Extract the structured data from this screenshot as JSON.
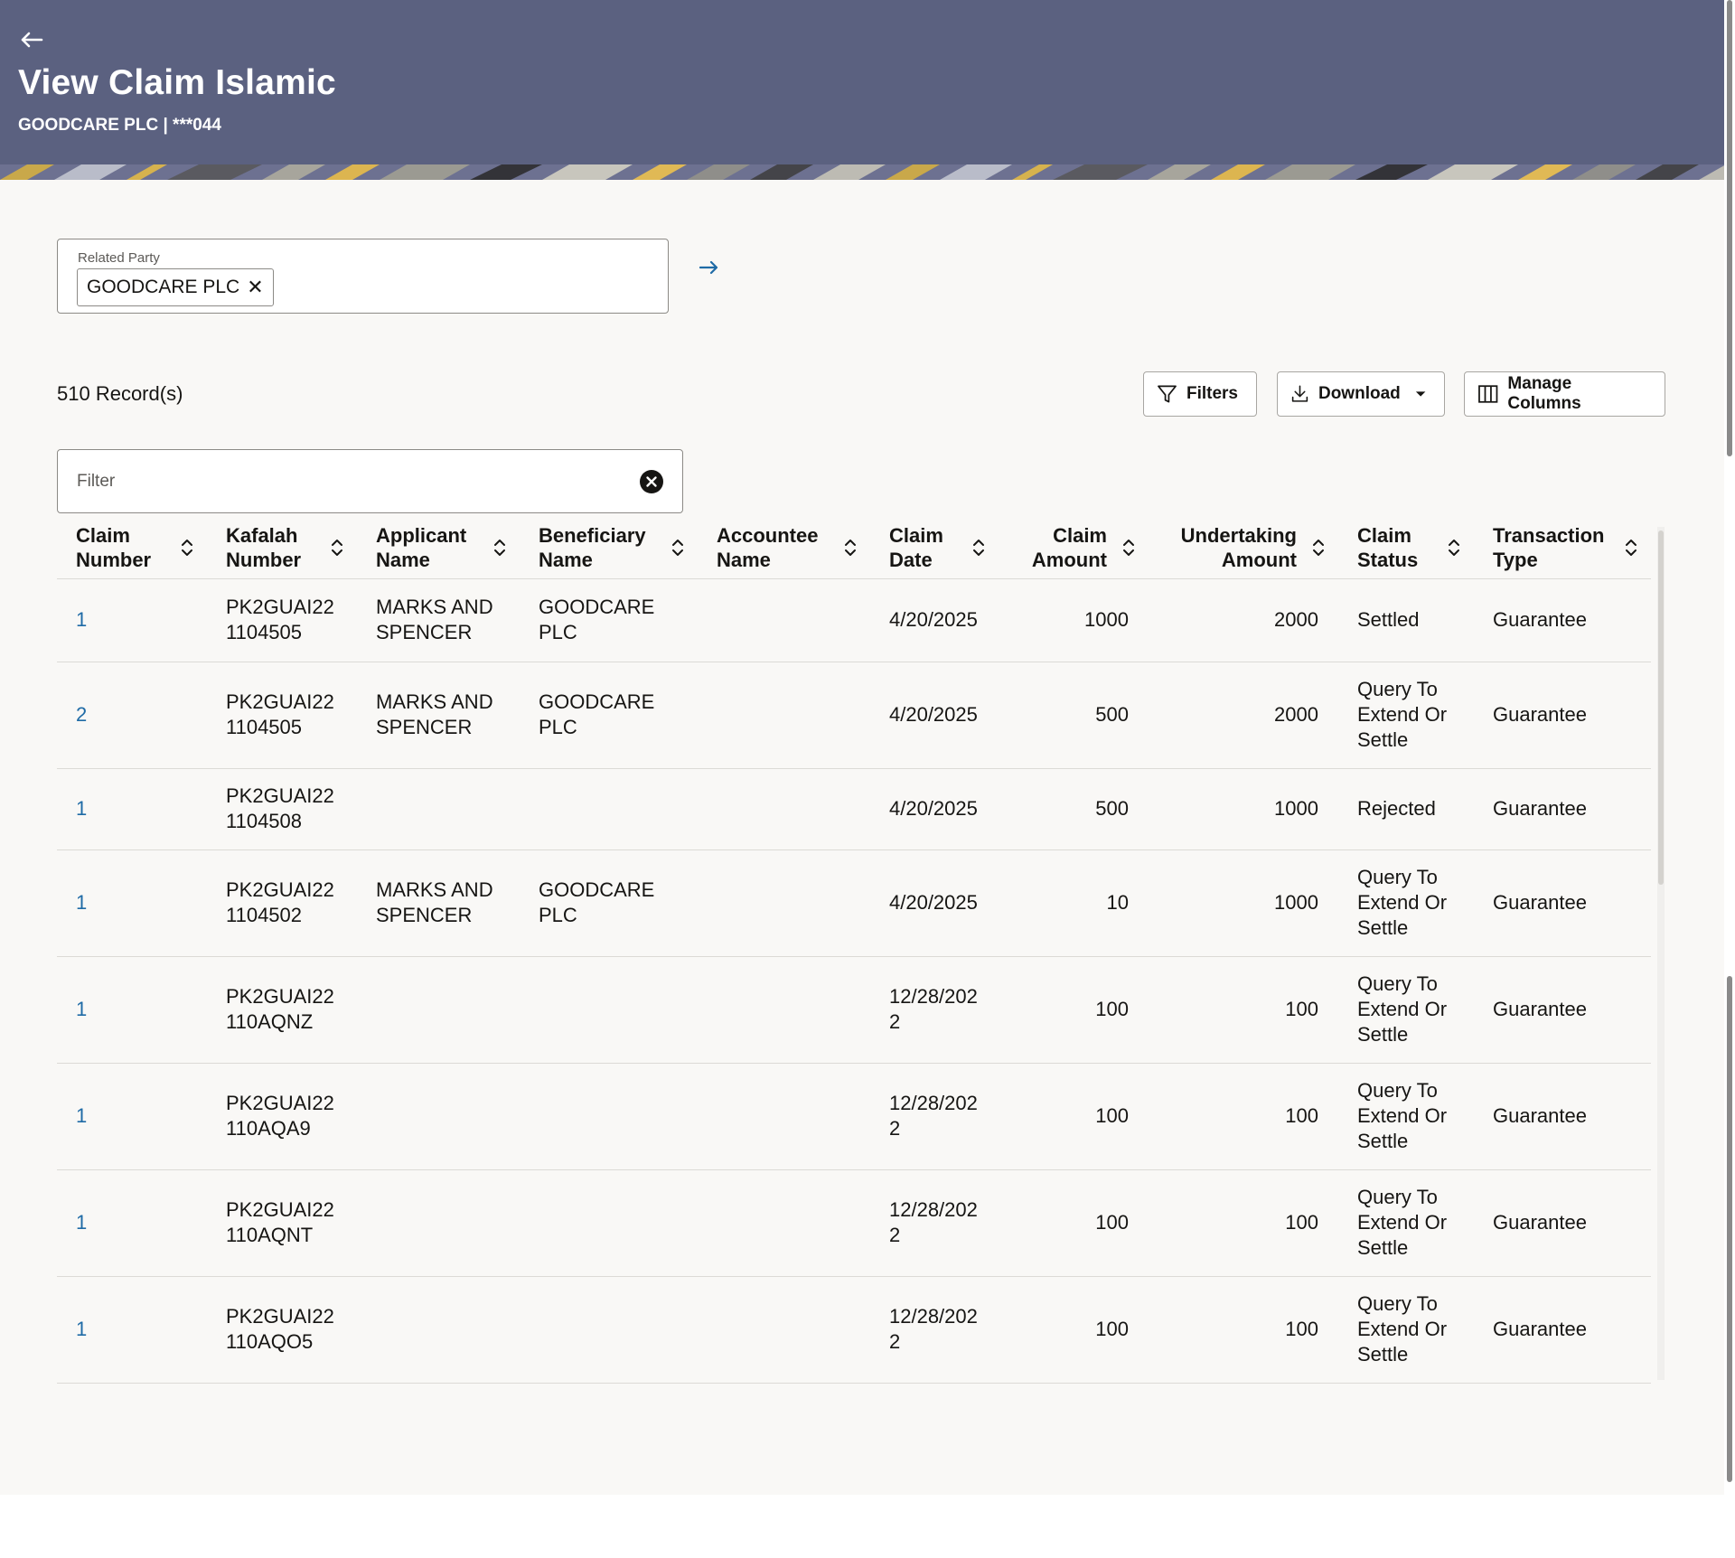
{
  "header": {
    "title": "View Claim Islamic",
    "subtitle": "GOODCARE PLC | ***044"
  },
  "related_party": {
    "label": "Related Party",
    "selected": "GOODCARE PLC"
  },
  "records_count": "510 Record(s)",
  "toolbar": {
    "filters_label": "Filters",
    "download_label": "Download",
    "manage_columns_label": "Manage Columns"
  },
  "filter": {
    "placeholder": "Filter",
    "value": ""
  },
  "table": {
    "columns": [
      "Claim Number",
      "Kafalah Number",
      "Applicant Name",
      "Beneficiary Name",
      "Accountee Name",
      "Claim Date",
      "Claim Amount",
      "Undertaking Amount",
      "Claim Status",
      "Transaction Type"
    ],
    "rows": [
      [
        "1",
        "PK2GUAI221104505",
        "MARKS AND SPENCER",
        "GOODCARE PLC",
        "",
        "4/20/2025",
        "1000",
        "2000",
        "Settled",
        "Guarantee"
      ],
      [
        "2",
        "PK2GUAI221104505",
        "MARKS AND SPENCER",
        "GOODCARE PLC",
        "",
        "4/20/2025",
        "500",
        "2000",
        "Query To Extend Or Settle",
        "Guarantee"
      ],
      [
        "1",
        "PK2GUAI221104508",
        "",
        "",
        "",
        "4/20/2025",
        "500",
        "1000",
        "Rejected",
        "Guarantee"
      ],
      [
        "1",
        "PK2GUAI221104502",
        "MARKS AND SPENCER",
        "GOODCARE PLC",
        "",
        "4/20/2025",
        "10",
        "1000",
        "Query To Extend Or Settle",
        "Guarantee"
      ],
      [
        "1",
        "PK2GUAI22110AQNZ",
        "",
        "",
        "",
        "12/28/2022",
        "100",
        "100",
        "Query To Extend Or Settle",
        "Guarantee"
      ],
      [
        "1",
        "PK2GUAI22110AQA9",
        "",
        "",
        "",
        "12/28/2022",
        "100",
        "100",
        "Query To Extend Or Settle",
        "Guarantee"
      ],
      [
        "1",
        "PK2GUAI22110AQNT",
        "",
        "",
        "",
        "12/28/2022",
        "100",
        "100",
        "Query To Extend Or Settle",
        "Guarantee"
      ],
      [
        "1",
        "PK2GUAI22110AQO5",
        "",
        "",
        "",
        "12/28/2022",
        "100",
        "100",
        "Query To Extend Or Settle",
        "Guarantee"
      ]
    ]
  },
  "colors": {
    "header_bg": "#5b6180",
    "link": "#1f6ba6",
    "page_bg": "#f9f8f6"
  },
  "icons": {
    "back": "arrow-left-icon",
    "go": "arrow-right-icon",
    "filters": "funnel-icon",
    "download": "download-icon",
    "columns": "columns-icon",
    "clear": "clear-circle-icon",
    "sort": "sort-icon"
  }
}
